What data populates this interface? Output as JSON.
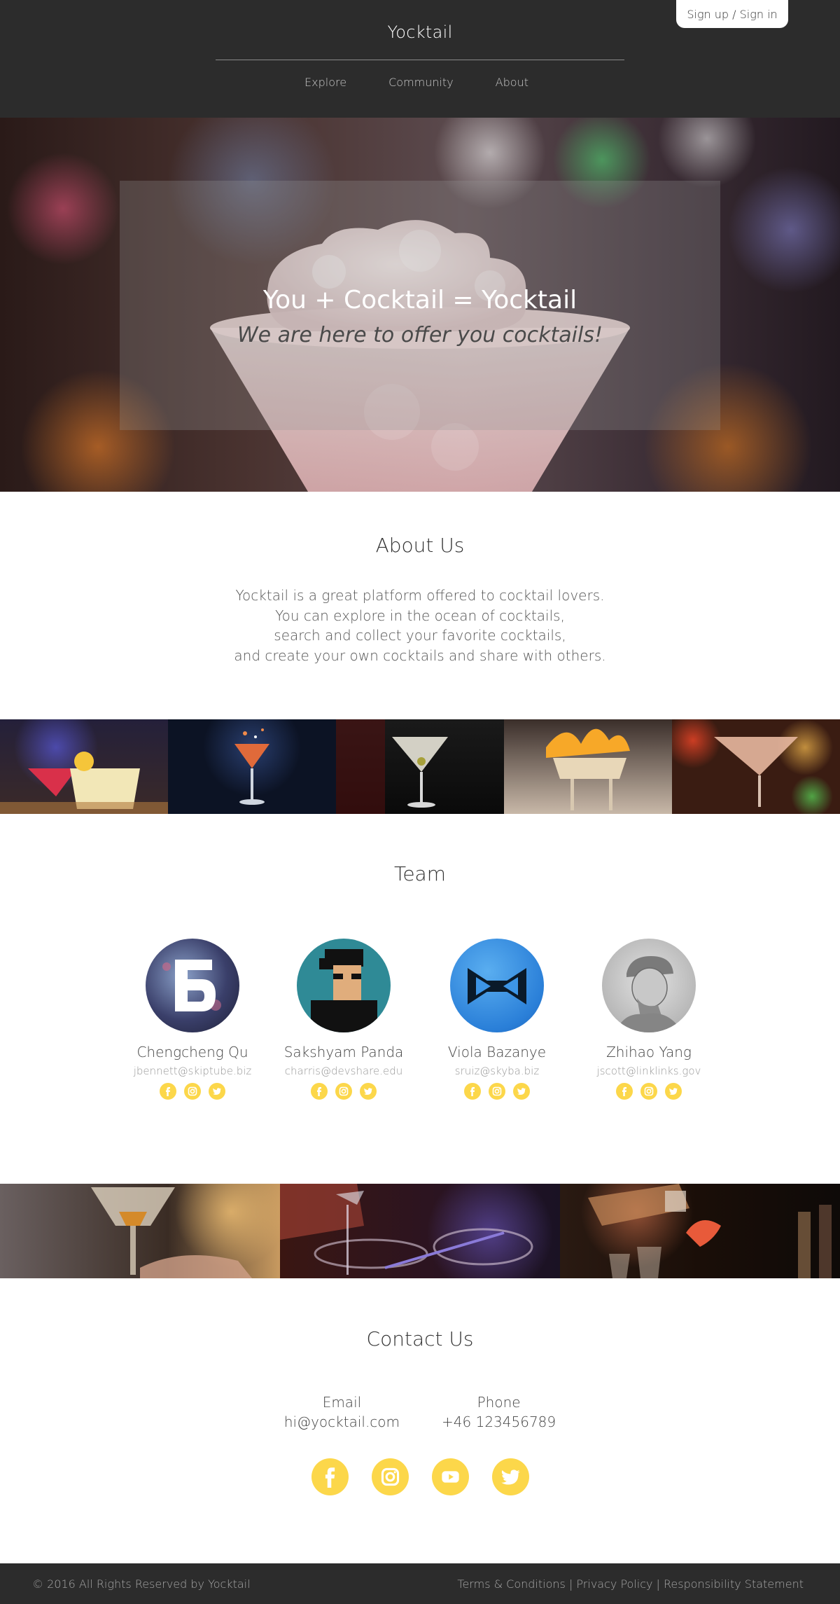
{
  "header": {
    "brand": "Yocktail",
    "signin_label": "Sign up / Sign in",
    "nav": [
      {
        "label": "Explore"
      },
      {
        "label": "Community"
      },
      {
        "label": "About"
      }
    ]
  },
  "hero": {
    "title": "You + Cocktail = Yocktail",
    "subtitle": "We are here to offer you cocktails!"
  },
  "about": {
    "title": "About Us",
    "lines": [
      "Yocktail is a great platform offered to cocktail lovers.",
      "You can explore in the ocean of cocktails,",
      "search and collect your favorite cocktails,",
      "and create your own cocktails and share with others."
    ]
  },
  "team": {
    "title": "Team",
    "members": [
      {
        "name": "Chengcheng Qu",
        "email": "jbennett@skiptube.biz"
      },
      {
        "name": "Sakshyam Panda",
        "email": "charris@devshare.edu"
      },
      {
        "name": "Viola Bazanye",
        "email": "sruiz@skyba.biz"
      },
      {
        "name": "Zhihao Yang",
        "email": "jscott@linklinks.gov"
      }
    ],
    "social_icons": [
      "facebook-icon",
      "instagram-icon",
      "twitter-icon"
    ]
  },
  "contact": {
    "title": "Contact Us",
    "email_label": "Email",
    "email_value": "hi@yocktail.com",
    "phone_label": "Phone",
    "phone_value": "+46 123456789",
    "social_icons": [
      "facebook-icon",
      "instagram-icon",
      "youtube-icon",
      "twitter-icon"
    ]
  },
  "footer": {
    "copyright": "© 2016 All Rights Reserved by Yocktail",
    "links": [
      {
        "label": "Terms & Conditions"
      },
      {
        "label": "Privacy Policy"
      },
      {
        "label": "Responsibility Statement"
      }
    ],
    "separator": " | "
  },
  "colors": {
    "header_bg": "#2c2c2c",
    "accent_yellow": "#fcd74a",
    "footer_text": "#a8a8a8"
  }
}
